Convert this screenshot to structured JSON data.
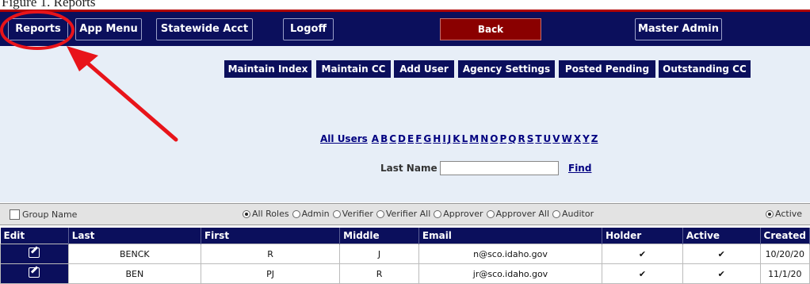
{
  "page_caption": "Figure 1. Reports",
  "nav": {
    "reports": "Reports",
    "app_menu": "App Menu",
    "statewide": "Statewide Acct",
    "logoff": "Logoff",
    "back": "Back",
    "master_admin": "Master Admin"
  },
  "subnav": [
    "Maintain Index",
    "Maintain CC",
    "Add User",
    "Agency Settings",
    "Posted Pending",
    "Outstanding CC"
  ],
  "letters": {
    "all_users": "All Users",
    "items": [
      "A",
      "B",
      "C",
      "D",
      "E",
      "F",
      "G",
      "H",
      "I",
      "J",
      "K",
      "L",
      "M",
      "N",
      "O",
      "P",
      "Q",
      "R",
      "S",
      "T",
      "U",
      "V",
      "W",
      "X",
      "Y",
      "Z"
    ]
  },
  "search": {
    "label": "Last Name",
    "value": "",
    "find": "Find"
  },
  "filters": {
    "group_name": "Group Name",
    "roles": [
      {
        "label": "All Roles",
        "selected": true
      },
      {
        "label": "Admin",
        "selected": false
      },
      {
        "label": "Verifier",
        "selected": false
      },
      {
        "label": "Verifier All",
        "selected": false
      },
      {
        "label": "Approver",
        "selected": false
      },
      {
        "label": "Approver All",
        "selected": false
      },
      {
        "label": "Auditor",
        "selected": false
      }
    ],
    "status": "Active"
  },
  "table": {
    "columns": [
      "Edit",
      "Last",
      "First",
      "Middle",
      "Email",
      "Holder",
      "Active",
      "Created"
    ],
    "rows": [
      {
        "last": "BENCK",
        "first": "R",
        "middle": "J",
        "email": "n@sco.idaho.gov",
        "holder": "✔",
        "active": "✔",
        "created": "10/20/20"
      },
      {
        "last": "BEN",
        "first": "PJ",
        "middle": "R",
        "email": "jr@sco.idaho.gov",
        "holder": "✔",
        "active": "✔",
        "created": "11/1/20"
      }
    ]
  },
  "colors": {
    "navy": "#0b0f5c",
    "back_red": "#8a0000",
    "panel": "#e7eef7",
    "annotation_red": "#e8141a"
  }
}
